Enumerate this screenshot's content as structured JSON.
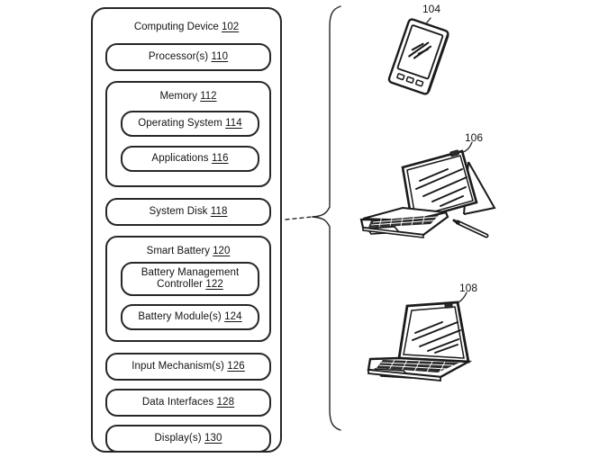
{
  "figure": {
    "type": "patent-block-diagram",
    "ink_color": "#262626",
    "background": "#ffffff"
  },
  "panel": {
    "title_text": "Computing Device ",
    "title_ref": "102",
    "boxes": [
      {
        "name": "processor",
        "label": "Processor(s) ",
        "ref": "110"
      },
      {
        "name": "memory",
        "label": "Memory ",
        "ref": "112"
      },
      {
        "name": "operating-system",
        "label": "Operating System ",
        "ref": "114"
      },
      {
        "name": "applications",
        "label": "Applications ",
        "ref": "116"
      },
      {
        "name": "system-disk",
        "label": "System Disk ",
        "ref": "118"
      },
      {
        "name": "smart-battery",
        "label": "Smart Battery ",
        "ref": "120"
      },
      {
        "name": "battery-management-controller",
        "label": "Battery Management Controller ",
        "ref": "122"
      },
      {
        "name": "battery-modules",
        "label": "Battery Module(s) ",
        "ref": "124"
      },
      {
        "name": "input-mechanisms",
        "label": "Input Mechanism(s) ",
        "ref": "126"
      },
      {
        "name": "data-interfaces",
        "label": "Data Interfaces ",
        "ref": "128"
      },
      {
        "name": "displays",
        "label": "Display(s) ",
        "ref": "130"
      }
    ]
  },
  "devices": [
    {
      "name": "smartphone",
      "ref": "104"
    },
    {
      "name": "detachable-tablet",
      "ref": "106"
    },
    {
      "name": "laptop",
      "ref": "108"
    }
  ],
  "connector": {
    "name": "dashed-link",
    "style": "dashed",
    "brace": "right-curly-brace"
  }
}
